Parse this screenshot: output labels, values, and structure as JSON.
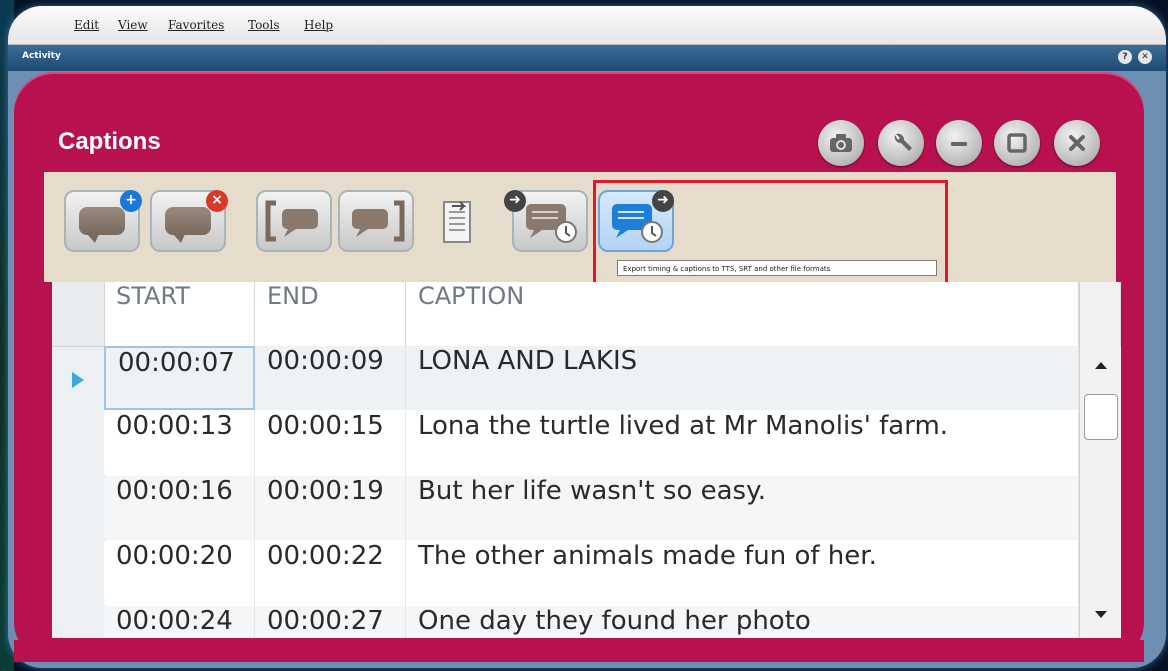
{
  "menubar": {
    "items": [
      "Edit",
      "View",
      "Favorites",
      "Tools",
      "Help"
    ]
  },
  "window": {
    "title": "Activity"
  },
  "panel": {
    "title": "Captions"
  },
  "toolbar": {
    "tooltip": "Export timing & captions to TTS, SRT and other file formats"
  },
  "grid": {
    "columns": [
      "START",
      "END",
      "CAPTION"
    ],
    "rows": [
      {
        "start": "00:00:07",
        "end": "00:00:09",
        "caption": "LONA AND LAKIS"
      },
      {
        "start": "00:00:13",
        "end": "00:00:15",
        "caption": "Lona the turtle lived at Mr Manolis' farm."
      },
      {
        "start": "00:00:16",
        "end": "00:00:19",
        "caption": "But her life wasn't so easy."
      },
      {
        "start": "00:00:20",
        "end": "00:00:22",
        "caption": "The other animals made fun of her."
      },
      {
        "start": "00:00:24",
        "end": "00:00:27",
        "caption": "One day they found her photo"
      }
    ]
  },
  "colors": {
    "panel": "#b7124f",
    "highlight": "#e0192b",
    "toolbar": "#e5dccb"
  }
}
